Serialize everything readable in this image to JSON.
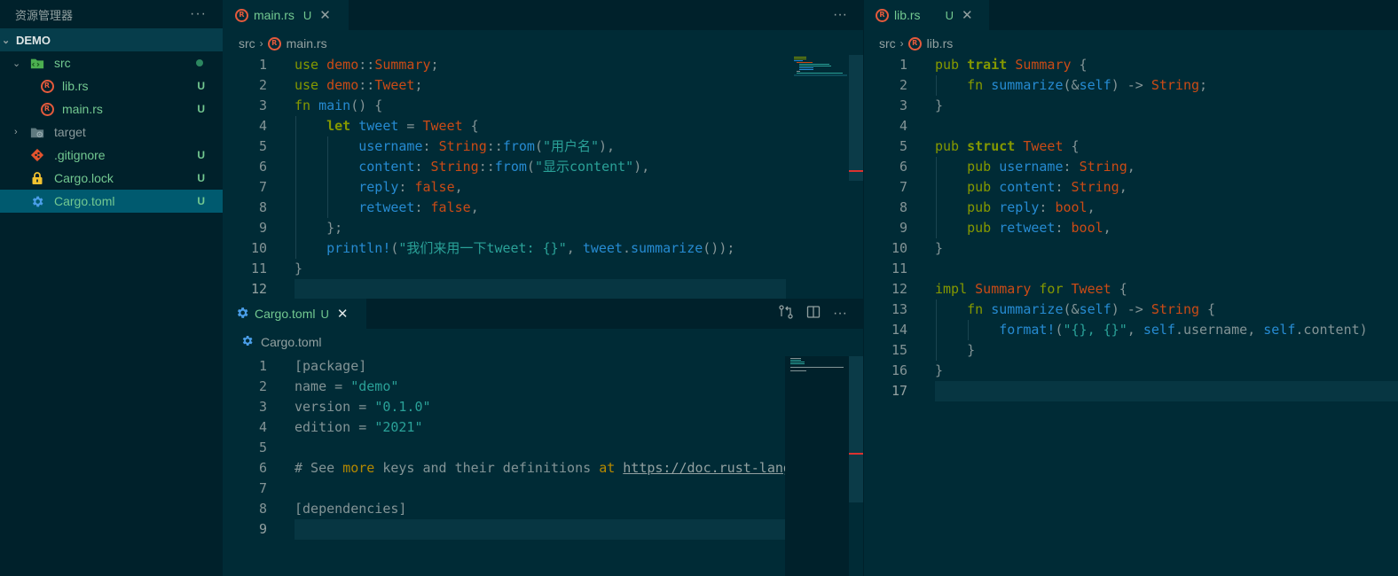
{
  "sidebar": {
    "title": "资源管理器",
    "more": "···",
    "project": "DEMO",
    "items": [
      {
        "name": "src",
        "badge": "",
        "kind": "folder-open"
      },
      {
        "name": "lib.rs",
        "badge": "U",
        "kind": "rust"
      },
      {
        "name": "main.rs",
        "badge": "U",
        "kind": "rust"
      },
      {
        "name": "target",
        "badge": "",
        "kind": "folder-closed"
      },
      {
        "name": ".gitignore",
        "badge": "U",
        "kind": "git"
      },
      {
        "name": "Cargo.lock",
        "badge": "U",
        "kind": "lock"
      },
      {
        "name": "Cargo.toml",
        "badge": "U",
        "kind": "gear"
      }
    ]
  },
  "editors": {
    "main": {
      "tab": {
        "label": "main.rs",
        "badge": "U",
        "close": "✕"
      },
      "actions_more": "···",
      "breadcrumb": {
        "folder": "src",
        "file": "main.rs"
      },
      "line_numbers": [
        "1",
        "2",
        "3",
        "4",
        "5",
        "6",
        "7",
        "8",
        "9",
        "10",
        "11",
        "12"
      ],
      "lines": [
        [
          [
            "kw",
            "use "
          ],
          [
            "ty",
            "demo"
          ],
          [
            "pl",
            "::"
          ],
          [
            "ty",
            "Summary"
          ],
          [
            "pl",
            ";"
          ]
        ],
        [
          [
            "kw",
            "use "
          ],
          [
            "ty",
            "demo"
          ],
          [
            "pl",
            "::"
          ],
          [
            "ty",
            "Tweet"
          ],
          [
            "pl",
            ";"
          ]
        ],
        [
          [
            "kw",
            "fn "
          ],
          [
            "fn",
            "main"
          ],
          [
            "pl",
            "() {"
          ]
        ],
        [
          [
            "pl",
            "    "
          ],
          [
            "kwb",
            "let "
          ],
          [
            "var",
            "tweet"
          ],
          [
            "pl",
            " = "
          ],
          [
            "ty",
            "Tweet"
          ],
          [
            "pl",
            " {"
          ]
        ],
        [
          [
            "pl",
            "        "
          ],
          [
            "var",
            "username"
          ],
          [
            "pl",
            ": "
          ],
          [
            "ty",
            "String"
          ],
          [
            "pl",
            "::"
          ],
          [
            "fn",
            "from"
          ],
          [
            "pl",
            "("
          ],
          [
            "str",
            "\"用户名\""
          ],
          [
            "pl",
            "),"
          ]
        ],
        [
          [
            "pl",
            "        "
          ],
          [
            "var",
            "content"
          ],
          [
            "pl",
            ": "
          ],
          [
            "ty",
            "String"
          ],
          [
            "pl",
            "::"
          ],
          [
            "fn",
            "from"
          ],
          [
            "pl",
            "("
          ],
          [
            "str",
            "\"显示content\""
          ],
          [
            "pl",
            "),"
          ]
        ],
        [
          [
            "pl",
            "        "
          ],
          [
            "var",
            "reply"
          ],
          [
            "pl",
            ": "
          ],
          [
            "ty",
            "false"
          ],
          [
            "pl",
            ","
          ]
        ],
        [
          [
            "pl",
            "        "
          ],
          [
            "var",
            "retweet"
          ],
          [
            "pl",
            ": "
          ],
          [
            "ty",
            "false"
          ],
          [
            "pl",
            ","
          ]
        ],
        [
          [
            "pl",
            "    };"
          ]
        ],
        [
          [
            "pl",
            "    "
          ],
          [
            "fn",
            "println!"
          ],
          [
            "pl",
            "("
          ],
          [
            "str",
            "\"我们来用一下tweet: {}\""
          ],
          [
            "pl",
            ", "
          ],
          [
            "var",
            "tweet"
          ],
          [
            "pl",
            "."
          ],
          [
            "fn",
            "summarize"
          ],
          [
            "pl",
            "());"
          ]
        ],
        [
          [
            "pl",
            "}"
          ]
        ],
        [
          [
            "pl",
            ""
          ]
        ]
      ]
    },
    "cargo": {
      "tab": {
        "label": "Cargo.toml",
        "badge": "U",
        "close": "✕"
      },
      "actions_more": "···",
      "breadcrumb": {
        "file": "Cargo.toml"
      },
      "line_numbers": [
        "1",
        "2",
        "3",
        "4",
        "5",
        "6",
        "7",
        "8",
        "9"
      ],
      "lines": [
        [
          [
            "pl",
            "[package]"
          ]
        ],
        [
          [
            "pl",
            "name = "
          ],
          [
            "str",
            "\"demo\""
          ]
        ],
        [
          [
            "pl",
            "version = "
          ],
          [
            "str",
            "\"0.1.0\""
          ]
        ],
        [
          [
            "pl",
            "edition = "
          ],
          [
            "str",
            "\"2021\""
          ]
        ],
        [
          [
            "pl",
            ""
          ]
        ],
        [
          [
            "pl",
            "# See "
          ],
          [
            "ty2",
            "more"
          ],
          [
            "pl",
            " keys and their definitions "
          ],
          [
            "ty2",
            "at"
          ],
          [
            "pl",
            " "
          ],
          [
            "link",
            "https://doc.rust-lang.org/cargo/reference/manifest.html"
          ]
        ],
        [
          [
            "pl",
            ""
          ]
        ],
        [
          [
            "pl",
            "[dependencies]"
          ]
        ],
        [
          [
            "pl",
            ""
          ]
        ]
      ]
    },
    "lib": {
      "tab": {
        "label": "lib.rs",
        "badge": "U",
        "close": "✕"
      },
      "breadcrumb": {
        "folder": "src",
        "file": "lib.rs"
      },
      "line_numbers": [
        "1",
        "2",
        "3",
        "4",
        "5",
        "6",
        "7",
        "8",
        "9",
        "10",
        "11",
        "12",
        "13",
        "14",
        "15",
        "16",
        "17"
      ],
      "lines": [
        [
          [
            "kw",
            "pub "
          ],
          [
            "kwb",
            "trait "
          ],
          [
            "ty",
            "Summary"
          ],
          [
            "pl",
            " {"
          ]
        ],
        [
          [
            "pl",
            "    "
          ],
          [
            "kw",
            "fn "
          ],
          [
            "fn",
            "summarize"
          ],
          [
            "pl",
            "(&"
          ],
          [
            "var",
            "self"
          ],
          [
            "pl",
            ") -> "
          ],
          [
            "ty",
            "String"
          ],
          [
            "pl",
            ";"
          ]
        ],
        [
          [
            "pl",
            "}"
          ]
        ],
        [
          [
            "pl",
            ""
          ]
        ],
        [
          [
            "kw",
            "pub "
          ],
          [
            "kwb",
            "struct "
          ],
          [
            "ty",
            "Tweet"
          ],
          [
            "pl",
            " {"
          ]
        ],
        [
          [
            "pl",
            "    "
          ],
          [
            "kw",
            "pub "
          ],
          [
            "var",
            "username"
          ],
          [
            "pl",
            ": "
          ],
          [
            "ty",
            "String"
          ],
          [
            "pl",
            ","
          ]
        ],
        [
          [
            "pl",
            "    "
          ],
          [
            "kw",
            "pub "
          ],
          [
            "var",
            "content"
          ],
          [
            "pl",
            ": "
          ],
          [
            "ty",
            "String"
          ],
          [
            "pl",
            ","
          ]
        ],
        [
          [
            "pl",
            "    "
          ],
          [
            "kw",
            "pub "
          ],
          [
            "var",
            "reply"
          ],
          [
            "pl",
            ": "
          ],
          [
            "ty",
            "bool"
          ],
          [
            "pl",
            ","
          ]
        ],
        [
          [
            "pl",
            "    "
          ],
          [
            "kw",
            "pub "
          ],
          [
            "var",
            "retweet"
          ],
          [
            "pl",
            ": "
          ],
          [
            "ty",
            "bool"
          ],
          [
            "pl",
            ","
          ]
        ],
        [
          [
            "pl",
            "}"
          ]
        ],
        [
          [
            "pl",
            ""
          ]
        ],
        [
          [
            "kw",
            "impl "
          ],
          [
            "ty",
            "Summary"
          ],
          [
            "kw",
            " for "
          ],
          [
            "ty",
            "Tweet"
          ],
          [
            "pl",
            " {"
          ]
        ],
        [
          [
            "pl",
            "    "
          ],
          [
            "kw",
            "fn "
          ],
          [
            "fn",
            "summarize"
          ],
          [
            "pl",
            "(&"
          ],
          [
            "var",
            "self"
          ],
          [
            "pl",
            ") -> "
          ],
          [
            "ty",
            "String"
          ],
          [
            "pl",
            " {"
          ]
        ],
        [
          [
            "pl",
            "        "
          ],
          [
            "fn",
            "format!"
          ],
          [
            "pl",
            "("
          ],
          [
            "str",
            "\"{}, {}\""
          ],
          [
            "pl",
            ", "
          ],
          [
            "var",
            "self"
          ],
          [
            "pl",
            ".username, "
          ],
          [
            "var",
            "self"
          ],
          [
            "pl",
            ".content)"
          ]
        ],
        [
          [
            "pl",
            "    }"
          ]
        ],
        [
          [
            "pl",
            "}"
          ]
        ],
        [
          [
            "pl",
            ""
          ]
        ]
      ]
    }
  },
  "colors": {
    "background": "#002b36",
    "sidebar": "#00212b",
    "untracked": "#73c991",
    "keyword": "#859900",
    "type": "#cb4b16",
    "function": "#268bd2",
    "string": "#2aa198"
  }
}
